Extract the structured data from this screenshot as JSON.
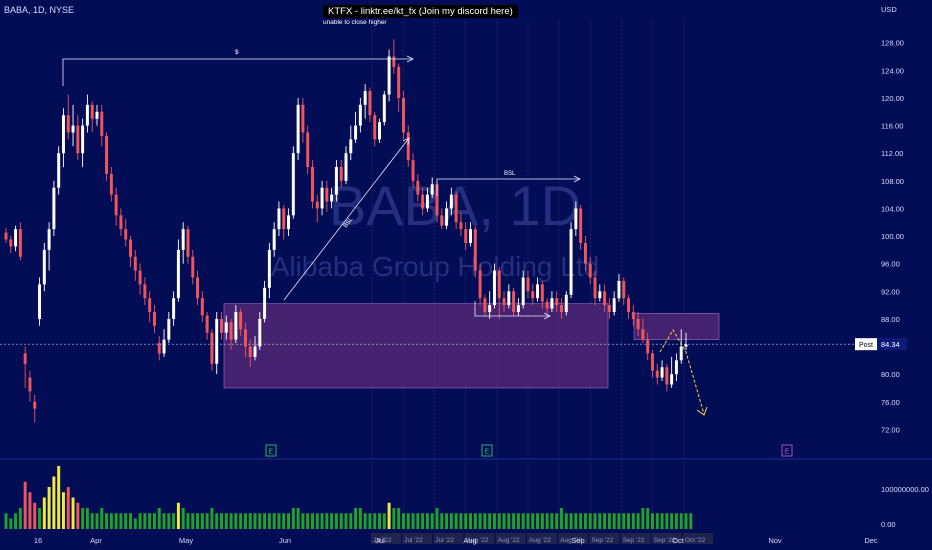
{
  "header": {
    "symbol": "BABA, 1D, NYSE",
    "banner": "KTFX - linktr.ee/kt_fx (Join my discord here)",
    "note": "unable to close higher",
    "currency": "USD"
  },
  "colors": {
    "background": "#030d55",
    "up": "#ffffff",
    "down": "#f0555c",
    "zone": "#5b2a78",
    "volume_up": "#1fa22a",
    "volume_down": "#1fa22a",
    "volume_hi_up": "#f2ea3c",
    "volume_hi_down": "#f0555c",
    "projection": "#ffd23a",
    "earnings_e": "#2fbf72",
    "earnings_future": "#b45cc8"
  },
  "chart_data": {
    "type": "candlestick",
    "title": "",
    "ylim": [
      68,
      131
    ],
    "y_ticks": [
      "128.00",
      "124.00",
      "120.00",
      "116.00",
      "112.00",
      "108.00",
      "104.00",
      "100.00",
      "96.00",
      "92.00",
      "88.00",
      "84.00",
      "80.00",
      "76.00",
      "72.00"
    ],
    "x_tick_labels": [
      "16",
      "Apr",
      "May",
      "Jun",
      "Jul",
      "Aug",
      "Sep",
      "Oct",
      "Nov",
      "Dec"
    ],
    "watermark": [
      "BABA, 1D",
      "Alibaba Group Holding Ltd"
    ],
    "price_label": {
      "label": "Post",
      "value": "84.34"
    },
    "annotations": {
      "dollar_label": "$",
      "bsl_label": "BSL",
      "bsl_slanted_label": "BSL",
      "earnings_markers": [
        "E",
        "E",
        "E"
      ]
    },
    "zones": [
      {
        "from_index": 40,
        "to_index": 131,
        "low": 78,
        "high": 90.2
      },
      {
        "from_index": 134,
        "to_index": 155,
        "low": 85,
        "high": 88.8
      }
    ],
    "session_labels": [
      "Jul '22",
      "Jul '22",
      "Jul '22",
      "Aug '22",
      "Aug '22",
      "Aug '22",
      "Aug '22",
      "Sep '22",
      "Sep '22",
      "Sep '22",
      "Oct '22"
    ],
    "volume": {
      "axis_ticks": [
        "100000000.00",
        "0.00"
      ],
      "ylim": [
        0,
        130000000
      ]
    },
    "candles": [
      [
        100.5,
        99.5,
        101.2,
        99.0
      ],
      [
        99.5,
        98.5,
        100.0,
        97.5
      ],
      [
        98.5,
        101.0,
        101.5,
        97.8
      ],
      [
        101.0,
        97.0,
        102.0,
        96.5
      ],
      [
        83.0,
        81.5,
        84.0,
        78.0
      ],
      [
        79.5,
        77.5,
        80.5,
        76.0
      ],
      [
        76.0,
        75.0,
        77.0,
        73.0
      ],
      [
        88.0,
        93.0,
        94.0,
        87.0
      ],
      [
        93.0,
        98.0,
        99.0,
        92.0
      ],
      [
        98.0,
        101.0,
        102.0,
        95.0
      ],
      [
        101.0,
        107.0,
        108.0,
        100.0
      ],
      [
        107.0,
        112.0,
        113.0,
        106.0
      ],
      [
        112.0,
        117.5,
        118.5,
        110.0
      ],
      [
        117.5,
        115.0,
        120.5,
        114.0
      ],
      [
        115.0,
        116.0,
        119.0,
        113.0
      ],
      [
        116.0,
        112.0,
        117.5,
        111.0
      ],
      [
        112.0,
        116.0,
        117.0,
        110.0
      ],
      [
        116.0,
        119.0,
        120.5,
        115.0
      ],
      [
        119.0,
        117.0,
        119.5,
        115.0
      ],
      [
        117.0,
        118.0,
        119.0,
        116.0
      ],
      [
        118.0,
        114.5,
        119.0,
        113.0
      ],
      [
        114.5,
        109.0,
        115.0,
        108.0
      ],
      [
        109.0,
        106.0,
        110.0,
        105.0
      ],
      [
        106.0,
        103.0,
        107.0,
        101.5
      ],
      [
        103.0,
        101.0,
        104.0,
        100.0
      ],
      [
        101.0,
        99.5,
        102.5,
        98.5
      ],
      [
        99.5,
        97.0,
        100.0,
        95.5
      ],
      [
        97.0,
        95.0,
        98.0,
        93.5
      ],
      [
        95.0,
        93.0,
        96.0,
        91.5
      ],
      [
        93.0,
        91.0,
        94.0,
        90.0
      ],
      [
        91.0,
        89.0,
        92.0,
        87.5
      ],
      [
        89.0,
        87.0,
        90.0,
        86.0
      ],
      [
        84.5,
        83.0,
        85.5,
        82.0
      ],
      [
        83.0,
        85.0,
        86.5,
        82.5
      ],
      [
        85.0,
        88.0,
        89.0,
        84.5
      ],
      [
        88.0,
        91.0,
        92.0,
        87.0
      ],
      [
        91.0,
        98.0,
        99.5,
        90.5
      ],
      [
        98.0,
        101.0,
        102.0,
        96.0
      ],
      [
        101.0,
        97.0,
        101.5,
        96.0
      ],
      [
        97.0,
        94.0,
        98.0,
        93.0
      ],
      [
        94.0,
        91.0,
        95.0,
        90.0
      ],
      [
        91.0,
        88.5,
        92.0,
        87.5
      ],
      [
        88.5,
        86.0,
        89.0,
        85.0
      ],
      [
        86.0,
        81.5,
        86.5,
        80.5
      ],
      [
        81.5,
        88.0,
        89.0,
        80.0
      ],
      [
        88.0,
        86.0,
        89.0,
        85.0
      ],
      [
        86.0,
        87.5,
        88.5,
        85.0
      ],
      [
        87.5,
        85.0,
        88.0,
        83.5
      ],
      [
        85.0,
        89.0,
        90.0,
        84.5
      ],
      [
        89.0,
        86.5,
        89.5,
        85.5
      ],
      [
        86.5,
        84.0,
        87.5,
        82.5
      ],
      [
        84.0,
        82.5,
        85.0,
        81.0
      ],
      [
        82.5,
        84.0,
        85.5,
        82.0
      ],
      [
        84.0,
        88.0,
        89.0,
        83.5
      ],
      [
        88.0,
        92.5,
        93.5,
        87.5
      ],
      [
        92.5,
        98.0,
        99.0,
        91.0
      ],
      [
        98.0,
        101.0,
        102.0,
        97.0
      ],
      [
        101.0,
        104.0,
        105.0,
        100.0
      ],
      [
        104.0,
        101.0,
        104.5,
        99.5
      ],
      [
        101.0,
        103.0,
        104.0,
        100.0
      ],
      [
        103.0,
        112.0,
        113.0,
        102.5
      ],
      [
        112.0,
        119.0,
        120.0,
        111.0
      ],
      [
        119.0,
        115.0,
        120.0,
        113.5
      ],
      [
        115.0,
        110.0,
        116.0,
        109.0
      ],
      [
        110.0,
        105.0,
        111.0,
        104.0
      ],
      [
        105.0,
        104.0,
        106.0,
        102.0
      ],
      [
        104.0,
        107.0,
        108.0,
        103.0
      ],
      [
        107.0,
        105.0,
        108.0,
        103.5
      ],
      [
        105.0,
        106.0,
        107.0,
        104.0
      ],
      [
        106.0,
        110.0,
        111.0,
        105.0
      ],
      [
        110.0,
        108.0,
        111.0,
        107.0
      ],
      [
        108.0,
        112.0,
        113.0,
        107.5
      ],
      [
        112.0,
        114.0,
        116.0,
        111.0
      ],
      [
        114.0,
        116.0,
        118.0,
        113.5
      ],
      [
        116.0,
        119.0,
        120.0,
        115.0
      ],
      [
        119.0,
        121.0,
        122.0,
        117.0
      ],
      [
        121.0,
        117.5,
        121.5,
        116.5
      ],
      [
        117.5,
        114.0,
        118.0,
        113.0
      ],
      [
        114.0,
        116.5,
        117.0,
        113.5
      ],
      [
        116.5,
        120.5,
        121.0,
        116.0
      ],
      [
        120.5,
        126.0,
        127.0,
        119.5
      ],
      [
        126.0,
        124.5,
        128.5,
        123.5
      ],
      [
        124.5,
        120.0,
        125.0,
        118.0
      ],
      [
        120.0,
        115.0,
        121.0,
        114.0
      ],
      [
        115.0,
        111.0,
        116.0,
        110.0
      ],
      [
        111.0,
        108.0,
        112.0,
        107.0
      ],
      [
        108.0,
        106.0,
        109.0,
        105.0
      ],
      [
        106.0,
        104.0,
        107.0,
        103.0
      ],
      [
        104.0,
        106.0,
        107.0,
        103.5
      ],
      [
        106.0,
        107.5,
        108.5,
        105.5
      ],
      [
        107.5,
        103.0,
        108.0,
        102.0
      ],
      [
        103.0,
        101.5,
        104.0,
        101.0
      ],
      [
        101.5,
        104.0,
        105.0,
        101.0
      ],
      [
        104.0,
        106.0,
        107.0,
        103.0
      ],
      [
        106.0,
        102.0,
        106.5,
        101.0
      ],
      [
        102.0,
        101.0,
        103.5,
        100.0
      ],
      [
        101.0,
        99.0,
        102.0,
        98.0
      ],
      [
        99.0,
        101.0,
        102.0,
        98.5
      ],
      [
        101.0,
        95.0,
        101.5,
        94.0
      ],
      [
        95.0,
        91.0,
        96.0,
        90.0
      ],
      [
        91.0,
        89.0,
        91.5,
        88.5
      ],
      [
        89.0,
        90.0,
        92.0,
        88.0
      ],
      [
        90.0,
        95.0,
        96.0,
        89.5
      ],
      [
        95.0,
        91.0,
        95.5,
        88.0
      ],
      [
        91.0,
        90.0,
        92.0,
        89.0
      ],
      [
        90.0,
        92.0,
        93.0,
        89.5
      ],
      [
        92.0,
        89.0,
        92.5,
        88.5
      ],
      [
        89.0,
        90.0,
        91.0,
        88.5
      ],
      [
        90.0,
        94.0,
        95.0,
        89.5
      ],
      [
        94.0,
        92.0,
        95.0,
        91.0
      ],
      [
        92.0,
        91.0,
        93.0,
        90.0
      ],
      [
        91.0,
        93.0,
        94.0,
        90.5
      ],
      [
        93.0,
        90.5,
        93.5,
        89.5
      ],
      [
        90.5,
        89.5,
        91.0,
        88.5
      ],
      [
        89.5,
        91.0,
        92.0,
        89.0
      ],
      [
        91.0,
        90.0,
        92.0,
        89.0
      ],
      [
        90.0,
        89.0,
        91.0,
        88.0
      ],
      [
        89.0,
        91.5,
        92.0,
        88.5
      ],
      [
        91.5,
        101.0,
        102.0,
        91.0
      ],
      [
        101.0,
        104.0,
        105.0,
        100.0
      ],
      [
        104.0,
        99.0,
        104.5,
        98.0
      ],
      [
        99.0,
        96.0,
        100.0,
        95.0
      ],
      [
        96.0,
        94.0,
        97.0,
        93.0
      ],
      [
        94.0,
        91.0,
        95.0,
        90.0
      ],
      [
        91.0,
        92.0,
        93.0,
        90.5
      ],
      [
        92.0,
        90.0,
        93.0,
        89.0
      ],
      [
        90.0,
        89.0,
        91.0,
        88.0
      ],
      [
        89.0,
        91.0,
        92.0,
        88.5
      ],
      [
        91.0,
        93.5,
        94.5,
        90.5
      ],
      [
        93.5,
        91.0,
        94.0,
        90.0
      ],
      [
        91.0,
        89.0,
        91.5,
        88.0
      ],
      [
        89.0,
        88.0,
        90.0,
        87.0
      ],
      [
        88.0,
        86.5,
        89.0,
        85.5
      ],
      [
        86.5,
        85.0,
        88.0,
        84.5
      ],
      [
        85.0,
        83.0,
        86.0,
        82.0
      ],
      [
        83.0,
        80.5,
        83.5,
        79.5
      ],
      [
        80.5,
        79.5,
        81.5,
        78.5
      ],
      [
        79.5,
        81.0,
        82.0,
        79.0
      ],
      [
        81.0,
        78.5,
        81.5,
        77.5
      ],
      [
        78.5,
        80.0,
        82.5,
        78.0
      ],
      [
        80.0,
        82.0,
        83.0,
        79.0
      ],
      [
        82.0,
        84.0,
        86.5,
        81.5
      ],
      [
        84.0,
        84.3,
        86.0,
        83.5
      ]
    ],
    "volume_series": [
      3,
      2,
      3,
      4,
      9,
      7,
      5,
      4,
      6,
      8,
      10,
      12,
      7,
      8,
      6,
      5,
      4,
      4,
      3,
      3,
      4,
      3,
      3,
      3,
      3,
      3,
      3,
      2,
      3,
      3,
      3,
      3,
      4,
      3,
      3,
      3,
      5,
      4,
      3,
      3,
      3,
      3,
      3,
      4,
      3,
      3,
      3,
      3,
      3,
      3,
      3,
      3,
      3,
      3,
      3,
      3,
      3,
      3,
      3,
      3,
      4,
      4,
      3,
      3,
      3,
      3,
      3,
      3,
      3,
      3,
      3,
      3,
      3,
      4,
      4,
      3,
      3,
      3,
      3,
      3,
      5,
      4,
      4,
      3,
      3,
      3,
      3,
      3,
      3,
      3,
      4,
      3,
      3,
      3,
      3,
      3,
      3,
      3,
      3,
      3,
      3,
      3,
      3,
      3,
      3,
      3,
      3,
      3,
      3,
      3,
      3,
      3,
      3,
      3,
      3,
      3,
      4,
      3,
      3,
      3,
      3,
      3,
      3,
      3,
      3,
      3,
      3,
      3,
      3,
      3,
      3,
      3,
      3,
      4,
      4,
      3,
      3,
      3,
      3,
      3,
      3,
      3,
      3,
      3
    ]
  }
}
